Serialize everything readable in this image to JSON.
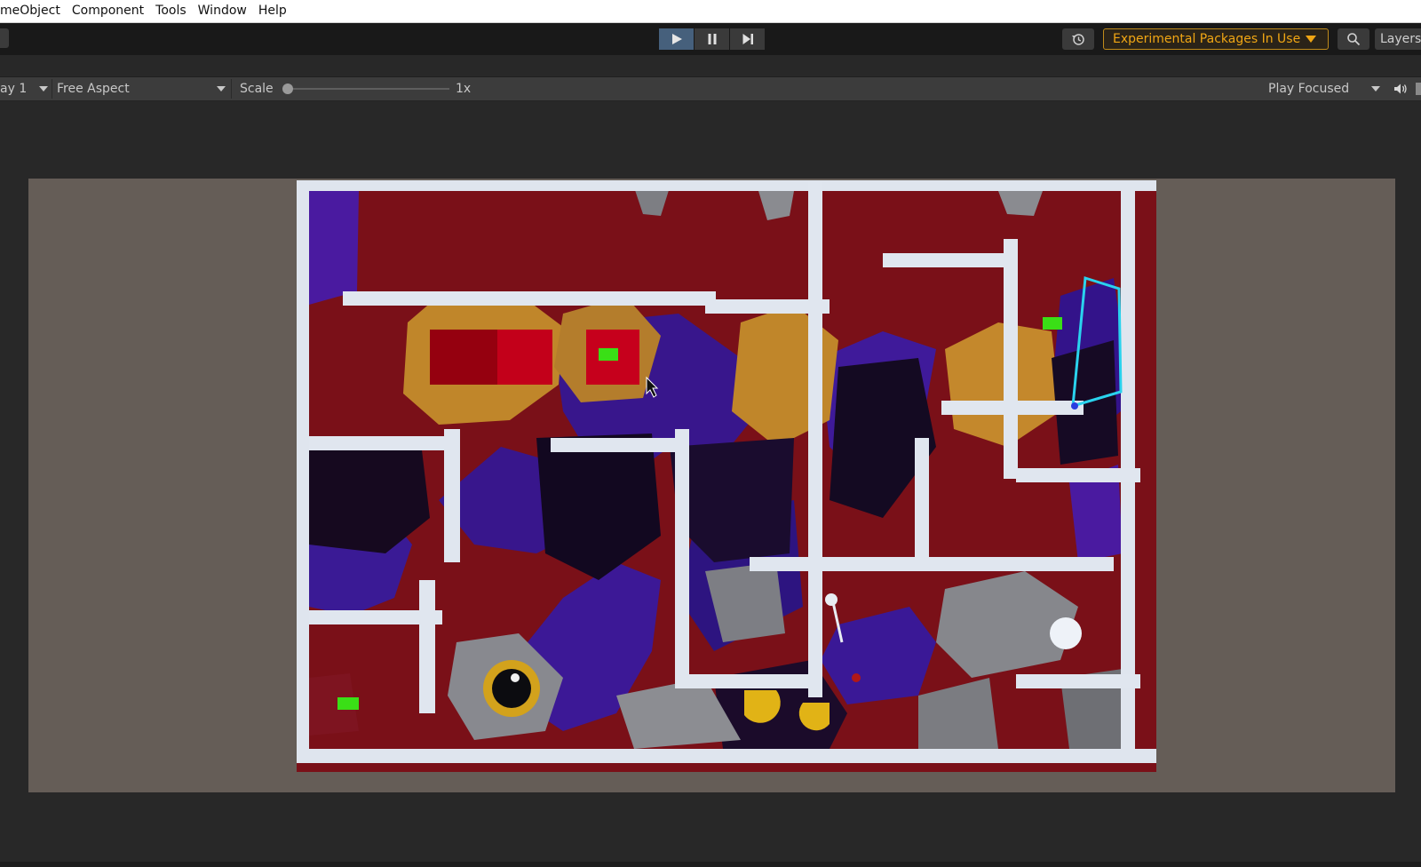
{
  "menu": {
    "items": [
      "meObject",
      "Component",
      "Tools",
      "Window",
      "Help"
    ]
  },
  "toolbar": {
    "experimental_label": "Experimental Packages In Use",
    "layers_label": "Layers",
    "play_icon": "play-icon",
    "pause_icon": "pause-icon",
    "step_icon": "step-icon"
  },
  "gameview": {
    "display_label": "ay 1",
    "aspect_label": "Free Aspect",
    "scale_label": "Scale",
    "scale_value": "1x",
    "scale_level": 0,
    "play_mode_label": "Play Focused"
  },
  "colors": {
    "accent_play": "#46607c",
    "experimental_text": "#f0a614",
    "letterbox": "#655d57",
    "wall": "#dfe5ee",
    "floor_red": "#7a1018",
    "floor_purple": "#38168c",
    "floor_orange": "#c0862a",
    "floor_dark": "#140a22",
    "goal_green": "#3adf16",
    "highlight_cyan": "#2ad3ee"
  }
}
